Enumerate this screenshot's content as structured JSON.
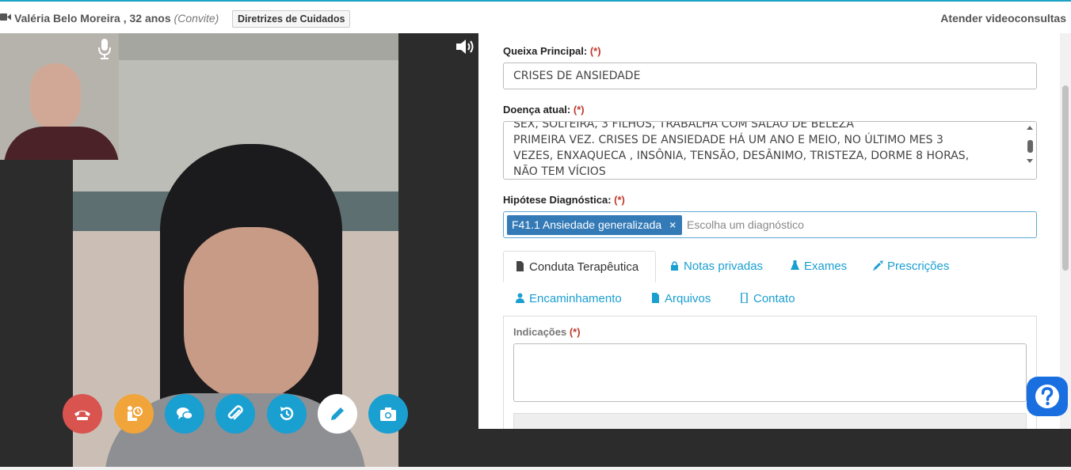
{
  "header": {
    "patient": "Valéria Belo Moreira , 32 anos",
    "invite": "(Convite)",
    "guidelines_button": "Diretrizes de Cuidados",
    "right_title": "Atender videoconsultas"
  },
  "colors": {
    "accent": "#1ba3c6",
    "hangup": "#d9534f",
    "orange": "#f0a43a",
    "blue": "#1a9fd1",
    "chip": "#337ab7"
  },
  "controls": [
    {
      "name": "hangup-button",
      "icon": "phone-hangup-icon"
    },
    {
      "name": "waiting-room-button",
      "icon": "clock-person-icon"
    },
    {
      "name": "chat-button",
      "icon": "chat-icon"
    },
    {
      "name": "attach-button",
      "icon": "paperclip-icon"
    },
    {
      "name": "history-button",
      "icon": "history-icon"
    },
    {
      "name": "edit-button",
      "icon": "pencil-icon"
    },
    {
      "name": "screenshot-button",
      "icon": "camera-icon"
    }
  ],
  "form": {
    "queixa_label": "Queixa Principal:",
    "queixa_value": "CRISES DE ANSIEDADE",
    "doenca_label": "Doença atual:",
    "doenca_lines": [
      "SEX, SOLTEIRA, 3 FILHOS, TRABALHA COM SALÃO DE BELEZA",
      "PRIMEIRA VEZ. CRISES DE ANSIEDADE HÁ UM ANO E MEIO, NO ÚLTIMO MES 3",
      "VEZES, ENXAQUECA , INSÔNIA, TENSÃO, DESÂNIMO, TRISTEZA, DORME 8 HORAS,",
      "NÃO TEM VÍCIOS"
    ],
    "hipotese_label": "Hipótese Diagnóstica:",
    "hipotese_chip": "F41.1 Ansiedade generalizada",
    "hipotese_placeholder": "Escolha um diagnóstico",
    "required_mark": "(*)"
  },
  "tabs": {
    "conduta": "Conduta Terapêutica",
    "notas": "Notas privadas",
    "exames": "Exames",
    "prescricoes": "Prescrições",
    "encaminhamento": "Encaminhamento",
    "arquivos": "Arquivos",
    "contato": "Contato"
  },
  "tab_content": {
    "indicacoes_label": "Indicações"
  }
}
